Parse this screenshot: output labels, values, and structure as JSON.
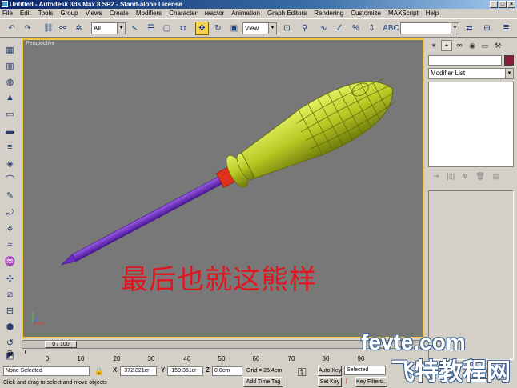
{
  "window": {
    "title": "Untitled - Autodesk 3ds Max 8 SP2 - Stand-alone License",
    "buttons": [
      "_",
      "□",
      "×"
    ]
  },
  "menu": [
    "File",
    "Edit",
    "Tools",
    "Group",
    "Views",
    "Create",
    "Modifiers",
    "Character",
    "reactor",
    "Animation",
    "Graph Editors",
    "Rendering",
    "Customize",
    "MAXScript",
    "Help"
  ],
  "toolbar": {
    "selection_filter": "All",
    "reference_coord": "View"
  },
  "viewport": {
    "label": "Perspective",
    "caption": "最后也就这熊样",
    "border_color": "#f2c53a",
    "background": "#787878"
  },
  "command_panel": {
    "modifier_list": "Modifier List",
    "object_color": "#8b1a3a"
  },
  "timeline": {
    "frame_display": "0 / 100",
    "ticks": [
      "0",
      "10",
      "20",
      "30",
      "40",
      "50",
      "60",
      "70",
      "80",
      "90"
    ]
  },
  "status": {
    "selection": "None Selected",
    "prompt": "Click and drag to select and move objects",
    "x_label": "X",
    "x_value": "-372.821cr",
    "y_label": "Y",
    "y_value": "-159.361cr",
    "z_label": "Z",
    "z_value": "0.0cm",
    "grid": "Grid = 25.4cm",
    "add_time_tag": "Add Time Tag",
    "auto_key": "Auto Key",
    "set_key": "Set Key",
    "key_mode_selected": "Selected",
    "key_filters": "Key Filters..."
  },
  "watermark": {
    "line1": "fevte.com",
    "line2": "飞特教程网"
  }
}
